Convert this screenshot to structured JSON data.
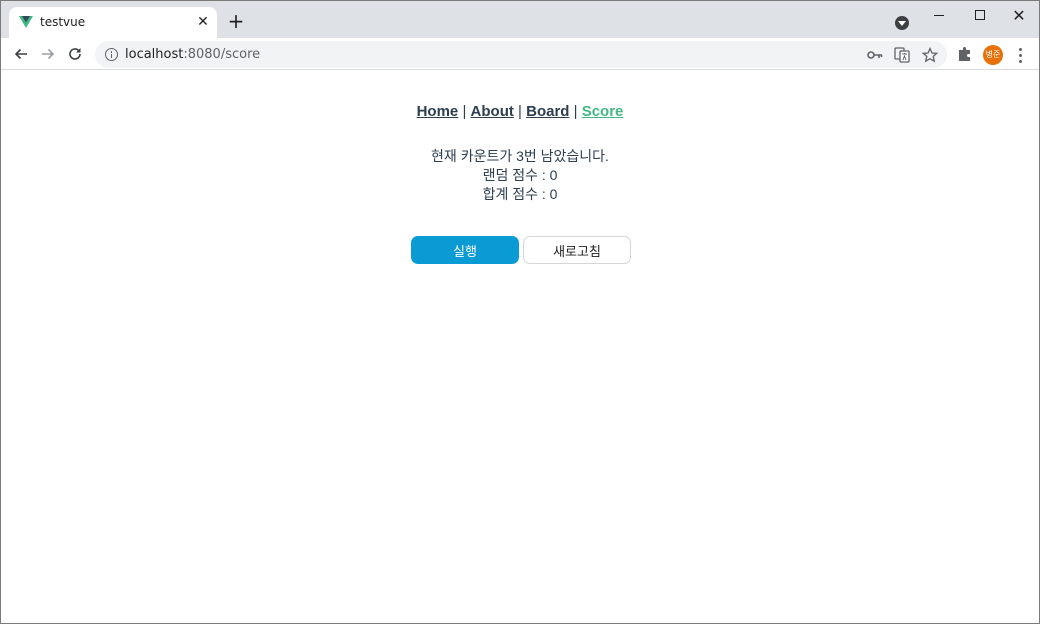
{
  "browser": {
    "tab": {
      "title": "testvue",
      "close_glyph": "✕"
    },
    "new_tab_glyph": "+",
    "window_close_glyph": "✕",
    "url_host": "localhost",
    "url_path": ":8080/score",
    "avatar_text": "병준",
    "icons": {
      "favicon": "vue-logo-icon",
      "back": "arrow-left-icon",
      "forward": "arrow-right-icon",
      "reload": "reload-icon",
      "info": "info-icon",
      "key": "key-icon",
      "translate": "translate-icon",
      "bookmark": "star-icon",
      "extensions": "puzzle-icon",
      "menu": "kebab-menu-icon",
      "tab_search": "tab-search-icon"
    },
    "colors": {
      "tabstrip": "#dee1e6",
      "avatar": "#e8710a",
      "vue_green": "#42b883",
      "vue_dark": "#35495e"
    }
  },
  "nav": {
    "items": [
      {
        "label": "Home",
        "active": false
      },
      {
        "label": "About",
        "active": false
      },
      {
        "label": "Board",
        "active": false
      },
      {
        "label": "Score",
        "active": true
      }
    ],
    "separator": "|",
    "colors": {
      "link": "#2c3e50",
      "active": "#42b983"
    }
  },
  "score": {
    "count_message": "현재 카운트가 3번 남았습니다.",
    "random_score": "랜덤 점수 : 0",
    "total_score": "합계 점수 : 0"
  },
  "buttons": {
    "run_label": "실행",
    "refresh_label": "새로고침",
    "colors": {
      "run_bg": "#0a9bd4",
      "run_text": "#ffffff"
    }
  }
}
